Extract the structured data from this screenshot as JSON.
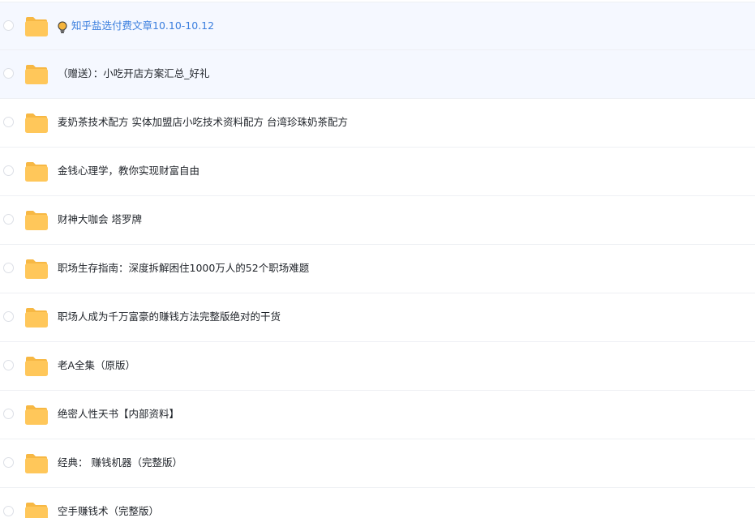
{
  "colors": {
    "folder_body": "#ffc75a",
    "folder_tab": "#f7b844",
    "link_text": "#3a7ede",
    "highlight_row": "#f5f8ff",
    "bulb": "#f5b43c"
  },
  "files": [
    {
      "name": "知乎盐选付费文章10.10-10.12",
      "icon": "folder-icon",
      "prefix_icon": "lightbulb-icon",
      "link": true,
      "highlight": true
    },
    {
      "name": "（赠送）：小吃开店方案汇总_好礼",
      "icon": "folder-icon",
      "highlight": true
    },
    {
      "name": "麦奶茶技术配方 实体加盟店小吃技术资料配方 台湾珍珠奶茶配方",
      "icon": "folder-icon"
    },
    {
      "name": "金钱心理学，教你实现财富自由",
      "icon": "folder-icon"
    },
    {
      "name": "财神大咖会 塔罗牌",
      "icon": "folder-icon"
    },
    {
      "name": "职场生存指南：深度拆解困住1000万人的52个职场难题",
      "icon": "folder-icon"
    },
    {
      "name": "职场人成为千万富豪的赚钱方法完整版绝对的干货",
      "icon": "folder-icon"
    },
    {
      "name": "老A全集（原版）",
      "icon": "folder-icon"
    },
    {
      "name": "绝密人性天书【内部资料】",
      "icon": "folder-icon"
    },
    {
      "name": "经典： 赚钱机器（完整版）",
      "icon": "folder-icon"
    },
    {
      "name": "空手赚钱术（完整版）",
      "icon": "folder-icon"
    }
  ]
}
